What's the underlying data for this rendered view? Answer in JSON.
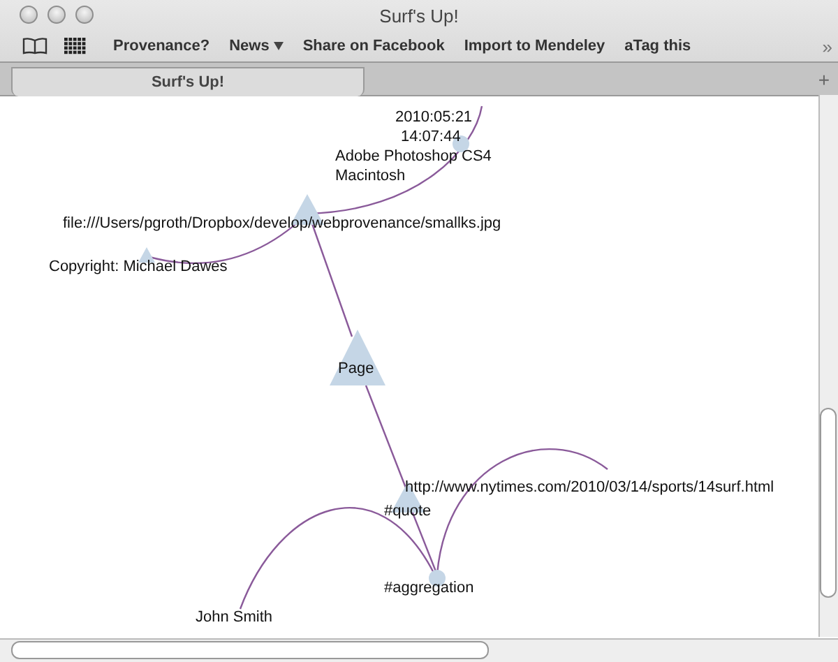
{
  "window": {
    "title": "Surf's Up!"
  },
  "bookmarks": [
    {
      "label": "Provenance?",
      "kind": "link"
    },
    {
      "label": "News",
      "kind": "menu"
    },
    {
      "label": "Share on Facebook",
      "kind": "link"
    },
    {
      "label": "Import to Mendeley",
      "kind": "link"
    },
    {
      "label": "aTag this",
      "kind": "link"
    }
  ],
  "bookmarks_overflow": "»",
  "tabs": [
    {
      "label": "Surf's Up!",
      "selected": true
    }
  ],
  "new_tab": "+",
  "graph": {
    "nodes": [
      {
        "kind": "circle",
        "lines": [
          "2010:05:21",
          "14:07:44",
          "Adobe Photoshop CS4",
          "Macintosh"
        ]
      },
      {
        "kind": "triangle",
        "lines": [
          "file:///Users/pgroth/Dropbox/develop/webprovenance/smallks.jpg"
        ]
      },
      {
        "kind": "small-triangle",
        "lines": [
          "Copyright: Michael Dawes"
        ]
      },
      {
        "kind": "big-triangle",
        "lines": [
          "Page"
        ]
      },
      {
        "kind": "label",
        "lines": [
          "http://www.nytimes.com/2010/03/14/sports/14surf.html"
        ]
      },
      {
        "kind": "triangle",
        "lines": [
          "#quote"
        ]
      },
      {
        "kind": "circle",
        "lines": [
          "#aggregation"
        ]
      },
      {
        "kind": "label",
        "lines": [
          "John Smith"
        ]
      }
    ]
  }
}
